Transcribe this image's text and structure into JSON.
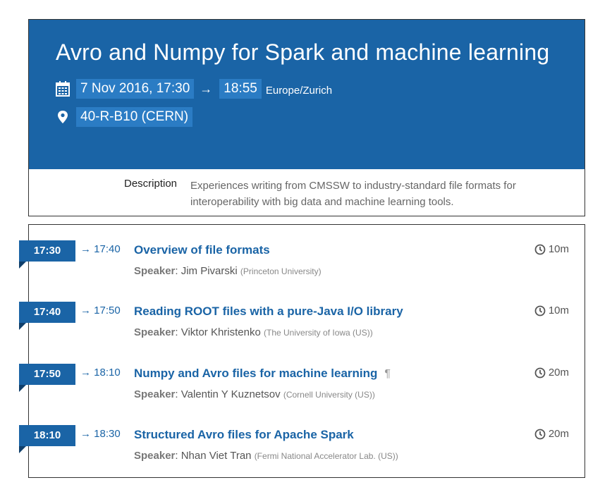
{
  "event": {
    "title": "Avro and Numpy for Spark and machine learning",
    "date_start": "7 Nov 2016, 17:30",
    "arrow": "→",
    "time_end": "18:55",
    "timezone": "Europe/Zurich",
    "location": "40-R-B10 (CERN)",
    "description_label": "Description",
    "description": "Experiences writing from CMSSW to industry-standard file formats for interoperability with big data and machine learning tools.",
    "header_color": "#1a64a6",
    "highlight_color": "#2b7cc4",
    "calendar_icon": "calendar-icon",
    "location_icon": "map-pin-icon"
  },
  "timetable": {
    "speaker_label": "Speaker",
    "clock_icon": "clock-icon",
    "items": [
      {
        "start": "17:30",
        "end": "→ 17:40",
        "title": "Overview of file formats",
        "duration": "10m",
        "speaker": "Jim Pivarski",
        "affiliation": "(Princeton University)",
        "pilcrow": ""
      },
      {
        "start": "17:40",
        "end": "→ 17:50",
        "title": "Reading ROOT files with a pure-Java I/O library",
        "duration": "10m",
        "speaker": "Viktor Khristenko",
        "affiliation": "(The University of Iowa (US))",
        "pilcrow": ""
      },
      {
        "start": "17:50",
        "end": "→ 18:10",
        "title": "Numpy and Avro files for machine learning",
        "duration": "20m",
        "speaker": "Valentin Y Kuznetsov",
        "affiliation": "(Cornell University (US))",
        "pilcrow": "¶"
      },
      {
        "start": "18:10",
        "end": "→ 18:30",
        "title": "Structured Avro files for Apache Spark",
        "duration": "20m",
        "speaker": "Nhan Viet Tran",
        "affiliation": "(Fermi National Accelerator Lab. (US))",
        "pilcrow": ""
      }
    ]
  }
}
